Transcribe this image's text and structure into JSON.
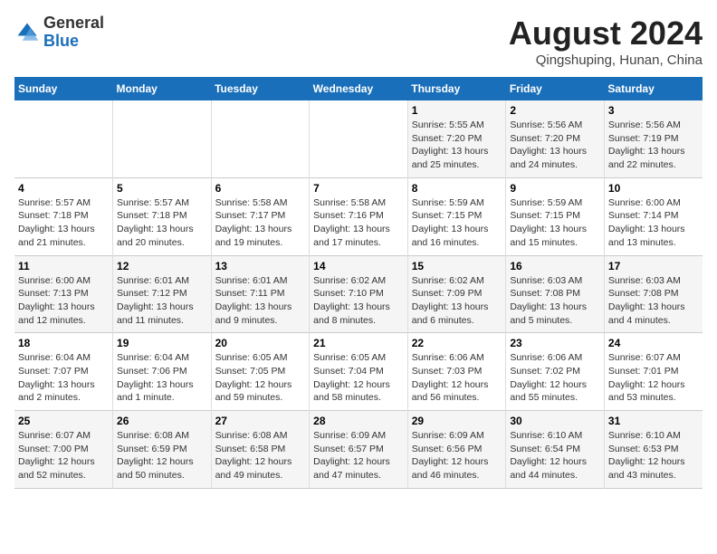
{
  "header": {
    "logo_general": "General",
    "logo_blue": "Blue",
    "month_year": "August 2024",
    "location": "Qingshuping, Hunan, China"
  },
  "days_of_week": [
    "Sunday",
    "Monday",
    "Tuesday",
    "Wednesday",
    "Thursday",
    "Friday",
    "Saturday"
  ],
  "weeks": [
    [
      {
        "day": "",
        "info": ""
      },
      {
        "day": "",
        "info": ""
      },
      {
        "day": "",
        "info": ""
      },
      {
        "day": "",
        "info": ""
      },
      {
        "day": "1",
        "info": "Sunrise: 5:55 AM\nSunset: 7:20 PM\nDaylight: 13 hours and 25 minutes."
      },
      {
        "day": "2",
        "info": "Sunrise: 5:56 AM\nSunset: 7:20 PM\nDaylight: 13 hours and 24 minutes."
      },
      {
        "day": "3",
        "info": "Sunrise: 5:56 AM\nSunset: 7:19 PM\nDaylight: 13 hours and 22 minutes."
      }
    ],
    [
      {
        "day": "4",
        "info": "Sunrise: 5:57 AM\nSunset: 7:18 PM\nDaylight: 13 hours and 21 minutes."
      },
      {
        "day": "5",
        "info": "Sunrise: 5:57 AM\nSunset: 7:18 PM\nDaylight: 13 hours and 20 minutes."
      },
      {
        "day": "6",
        "info": "Sunrise: 5:58 AM\nSunset: 7:17 PM\nDaylight: 13 hours and 19 minutes."
      },
      {
        "day": "7",
        "info": "Sunrise: 5:58 AM\nSunset: 7:16 PM\nDaylight: 13 hours and 17 minutes."
      },
      {
        "day": "8",
        "info": "Sunrise: 5:59 AM\nSunset: 7:15 PM\nDaylight: 13 hours and 16 minutes."
      },
      {
        "day": "9",
        "info": "Sunrise: 5:59 AM\nSunset: 7:15 PM\nDaylight: 13 hours and 15 minutes."
      },
      {
        "day": "10",
        "info": "Sunrise: 6:00 AM\nSunset: 7:14 PM\nDaylight: 13 hours and 13 minutes."
      }
    ],
    [
      {
        "day": "11",
        "info": "Sunrise: 6:00 AM\nSunset: 7:13 PM\nDaylight: 13 hours and 12 minutes."
      },
      {
        "day": "12",
        "info": "Sunrise: 6:01 AM\nSunset: 7:12 PM\nDaylight: 13 hours and 11 minutes."
      },
      {
        "day": "13",
        "info": "Sunrise: 6:01 AM\nSunset: 7:11 PM\nDaylight: 13 hours and 9 minutes."
      },
      {
        "day": "14",
        "info": "Sunrise: 6:02 AM\nSunset: 7:10 PM\nDaylight: 13 hours and 8 minutes."
      },
      {
        "day": "15",
        "info": "Sunrise: 6:02 AM\nSunset: 7:09 PM\nDaylight: 13 hours and 6 minutes."
      },
      {
        "day": "16",
        "info": "Sunrise: 6:03 AM\nSunset: 7:08 PM\nDaylight: 13 hours and 5 minutes."
      },
      {
        "day": "17",
        "info": "Sunrise: 6:03 AM\nSunset: 7:08 PM\nDaylight: 13 hours and 4 minutes."
      }
    ],
    [
      {
        "day": "18",
        "info": "Sunrise: 6:04 AM\nSunset: 7:07 PM\nDaylight: 13 hours and 2 minutes."
      },
      {
        "day": "19",
        "info": "Sunrise: 6:04 AM\nSunset: 7:06 PM\nDaylight: 13 hours and 1 minute."
      },
      {
        "day": "20",
        "info": "Sunrise: 6:05 AM\nSunset: 7:05 PM\nDaylight: 12 hours and 59 minutes."
      },
      {
        "day": "21",
        "info": "Sunrise: 6:05 AM\nSunset: 7:04 PM\nDaylight: 12 hours and 58 minutes."
      },
      {
        "day": "22",
        "info": "Sunrise: 6:06 AM\nSunset: 7:03 PM\nDaylight: 12 hours and 56 minutes."
      },
      {
        "day": "23",
        "info": "Sunrise: 6:06 AM\nSunset: 7:02 PM\nDaylight: 12 hours and 55 minutes."
      },
      {
        "day": "24",
        "info": "Sunrise: 6:07 AM\nSunset: 7:01 PM\nDaylight: 12 hours and 53 minutes."
      }
    ],
    [
      {
        "day": "25",
        "info": "Sunrise: 6:07 AM\nSunset: 7:00 PM\nDaylight: 12 hours and 52 minutes."
      },
      {
        "day": "26",
        "info": "Sunrise: 6:08 AM\nSunset: 6:59 PM\nDaylight: 12 hours and 50 minutes."
      },
      {
        "day": "27",
        "info": "Sunrise: 6:08 AM\nSunset: 6:58 PM\nDaylight: 12 hours and 49 minutes."
      },
      {
        "day": "28",
        "info": "Sunrise: 6:09 AM\nSunset: 6:57 PM\nDaylight: 12 hours and 47 minutes."
      },
      {
        "day": "29",
        "info": "Sunrise: 6:09 AM\nSunset: 6:56 PM\nDaylight: 12 hours and 46 minutes."
      },
      {
        "day": "30",
        "info": "Sunrise: 6:10 AM\nSunset: 6:54 PM\nDaylight: 12 hours and 44 minutes."
      },
      {
        "day": "31",
        "info": "Sunrise: 6:10 AM\nSunset: 6:53 PM\nDaylight: 12 hours and 43 minutes."
      }
    ]
  ]
}
